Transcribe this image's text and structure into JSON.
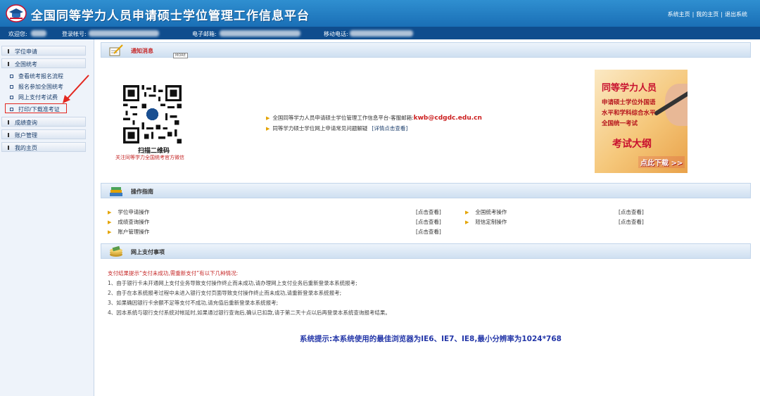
{
  "header": {
    "title": "全国同等学力人员申请硕士学位管理工作信息平台",
    "links": [
      "系统主页",
      "我的主页",
      "退出系统"
    ]
  },
  "userbar": {
    "welcome_label": "欢迎您:",
    "account_label": "登录帐号:",
    "email_label": "电子邮箱:",
    "phone_label": "移动电话:"
  },
  "sidebar": {
    "sections": [
      {
        "label": "学位申请"
      },
      {
        "label": "全国统考",
        "items": [
          "查看统考报名流程",
          "报名参加全国统考",
          "网上支付考试费",
          "打印/下载准考证"
        ]
      },
      {
        "label": "成绩查询"
      },
      {
        "label": "账户管理"
      },
      {
        "label": "我的主页"
      }
    ]
  },
  "notice": {
    "heading": "通知消息",
    "more": "MORE",
    "qr_caption": "扫描二维码",
    "qr_sub": "关注同等学力全国统考官方微信",
    "line1_text": "全国同等学力人员申请硕士学位管理工作信息平台-客服邮箱:",
    "line1_email": "kwb@cdgdc.edu.cn",
    "line2_text": "同等学力硕士学位网上申请常见问题解疑",
    "line2_link": "[详情点击查看]",
    "banner": {
      "line1": "同等学力人员",
      "line2": "申请硕士学位外国语",
      "line3": "水平和学科综合水平",
      "line4": "全国统一考试",
      "line5": "考试大纲",
      "line6": "点此下载 >>"
    }
  },
  "guide": {
    "heading": "操作指南",
    "left": [
      {
        "label": "学位申请操作",
        "link": "[点击查看]"
      },
      {
        "label": "成绩查询操作",
        "link": "[点击查看]"
      },
      {
        "label": "账户管理操作",
        "link": "[点击查看]"
      }
    ],
    "right": [
      {
        "label": "全国统考操作",
        "link": "[点击查看]"
      },
      {
        "label": "短信定制操作",
        "link": "[点击查看]"
      }
    ]
  },
  "payment": {
    "heading": "网上支付事项",
    "intro": "支付结果提示“支付未成功,需重新支付”有以下几种情况:",
    "items": [
      "1、由于银行卡未开通网上支付业务导致支付操作终止而未成功,请办理网上支付业务后重新登录本系统报考;",
      "2、由于在本系统报考过程中未进入银行支付页面导致支付操作终止而未成功,请重新登录本系统报考;",
      "3、如果确因银行卡余额不足等支付不成功,请充值后重新登录本系统报考;",
      "4、因本系统与银行支付系统对帐延时,如果通过银行查询后,确认已扣款,请于第二天十点以后再登录本系统查询报考结果。"
    ]
  },
  "system_hint": "系统提示:本系统使用的最佳浏览器为IE6、IE7、IE8,最小分辨率为1024*768",
  "colors": {
    "header": "#1a6fb6",
    "userbar": "#0f4d8e",
    "accent_red": "#c62828",
    "hint_blue": "#2336a8"
  }
}
